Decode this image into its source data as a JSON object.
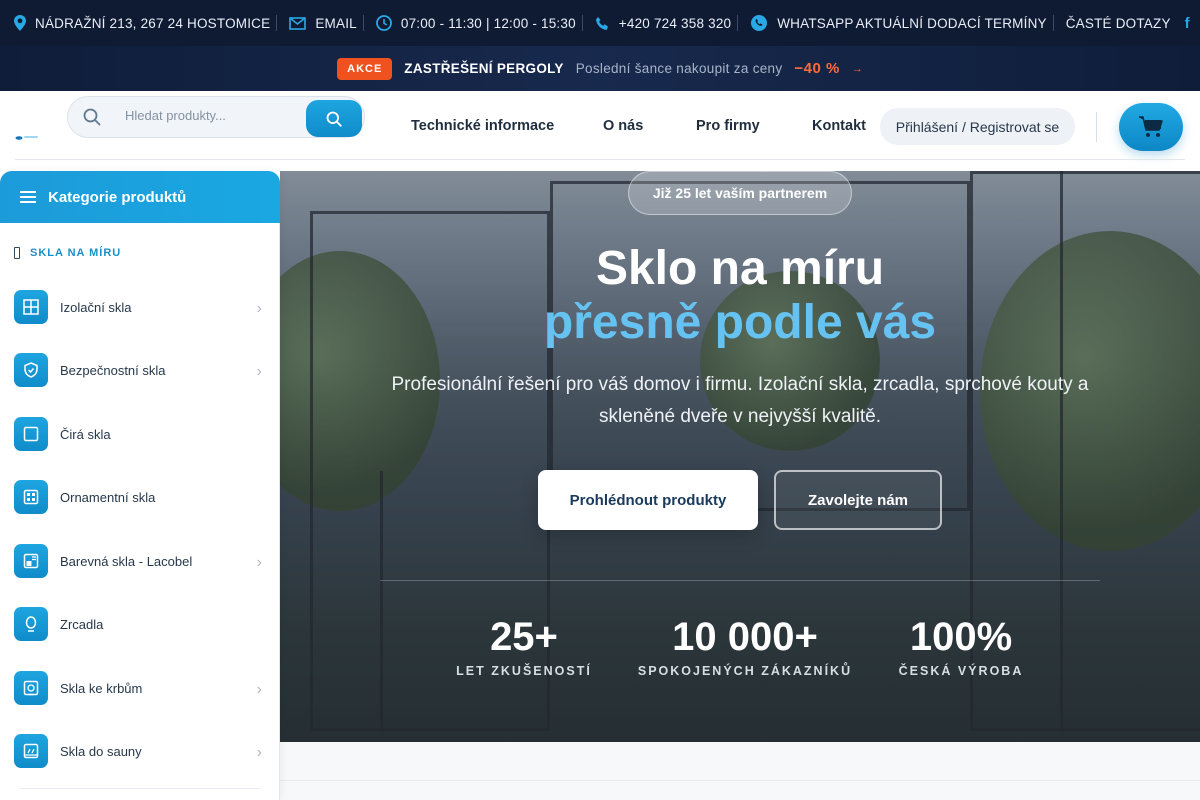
{
  "topbar": {
    "address": "NÁDRAŽNÍ 213, 267 24 HOSTOMICE",
    "email": "EMAIL",
    "hours": "07:00 - 11:30 | 12:00 - 15:30",
    "phone": "+420 724 358 320",
    "whatsapp": "WHATSAPP",
    "delivery": "AKTUÁLNÍ DODACÍ TERMÍNY",
    "faq": "ČASTÉ DOTAZY",
    "facebook": "f"
  },
  "promo": {
    "badge": "AKCE",
    "title": "ZASTŘEŠENÍ PERGOLY",
    "text": "Poslední šance nakoupit za ceny",
    "discount": "−40 %",
    "arrow": "→"
  },
  "header": {
    "search_placeholder": "Hledat produkty...",
    "nav": [
      "Technické informace",
      "O nás",
      "Pro firmy",
      "Kontakt"
    ],
    "login": "Přihlášení / Registrovat se"
  },
  "sidebar": {
    "title": "Kategorie produktů",
    "section": "SKLA NA MÍRU",
    "items": [
      {
        "label": "Izolační skla",
        "icon": "window-grid-icon",
        "chevron": "›"
      },
      {
        "label": "Bezpečnostní skla",
        "icon": "shield-check-icon",
        "chevron": "›"
      },
      {
        "label": "Čirá skla",
        "icon": "square-icon",
        "chevron": ""
      },
      {
        "label": "Ornamentní skla",
        "icon": "pattern-icon",
        "chevron": ""
      },
      {
        "label": "Barevná skla - Lacobel",
        "icon": "palette-icon",
        "chevron": "›"
      },
      {
        "label": "Zrcadla",
        "icon": "mirror-icon",
        "chevron": ""
      },
      {
        "label": "Skla ke krbům",
        "icon": "fireplace-icon",
        "chevron": "›"
      },
      {
        "label": "Skla do sauny",
        "icon": "sauna-icon",
        "chevron": "›"
      }
    ]
  },
  "hero": {
    "badge": "Již 25 let vaším partnerem",
    "title": "Sklo na míru",
    "title_highlight": "přesně podle vás",
    "lead": "Profesionální řešení pro váš domov i firmu. Izolační skla, zrcadla, sprchové kouty a skleněné dveře v nejvyšší kvalitě.",
    "primary_button": "Prohlédnout produkty",
    "secondary_button": "Zavolejte nám",
    "stats": [
      {
        "value": "25+",
        "label": "LET ZKUŠENOSTÍ"
      },
      {
        "value": "10 000+",
        "label": "SPOKOJENÝCH ZÁKAZNÍKŮ"
      },
      {
        "value": "100%",
        "label": "ČESKÁ VÝROBA"
      }
    ]
  },
  "colors": {
    "accent": "#1ea5e0",
    "topbar_bg": "#0f1b33",
    "promo_badge": "#f0521f",
    "highlight_text": "#66c3f1"
  }
}
